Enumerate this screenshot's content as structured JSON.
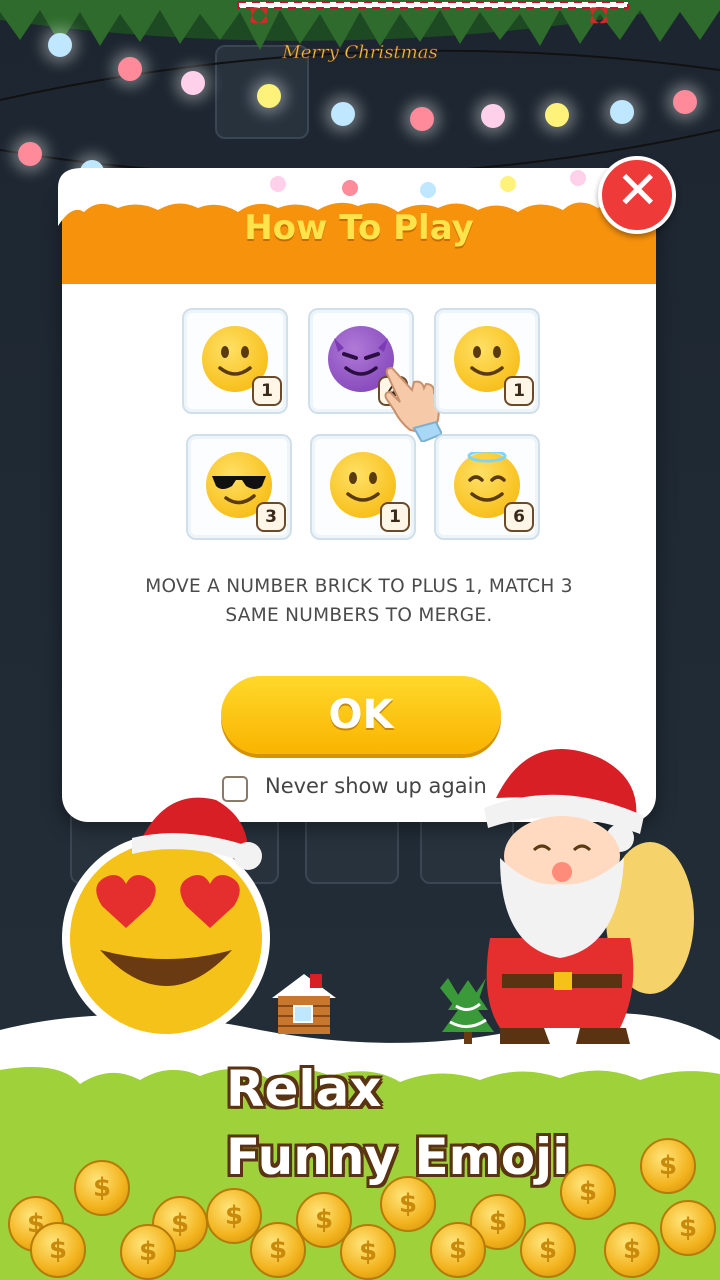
{
  "banner": {
    "text": "Merry Christmas"
  },
  "dialog": {
    "title": "How To Play",
    "close_symbol": "✕",
    "grid": [
      {
        "emoji": "slightly-smiling-face",
        "number": "1"
      },
      {
        "emoji": "smiling-devil-face",
        "number": "4"
      },
      {
        "emoji": "slightly-smiling-face",
        "number": "1"
      },
      {
        "emoji": "sunglasses-face",
        "number": "3"
      },
      {
        "emoji": "slightly-smiling-face",
        "number": "1"
      },
      {
        "emoji": "halo-face",
        "number": "6"
      }
    ],
    "instructions_line1": "MOVE A NUMBER BRICK TO PLUS 1, MATCH 3",
    "instructions_line2": "SAME NUMBERS TO MERGE.",
    "ok_label": "OK",
    "never_show_label": "Never show up again"
  },
  "tagline": {
    "line1": "Relax",
    "line2": "Funny Emoji"
  },
  "colors": {
    "header_orange": "#f7920d",
    "title_yellow": "#ffe34a",
    "ok_yellow": "#ffd82a",
    "close_red": "#ef3a3a",
    "ground_green": "#9ed13a"
  }
}
